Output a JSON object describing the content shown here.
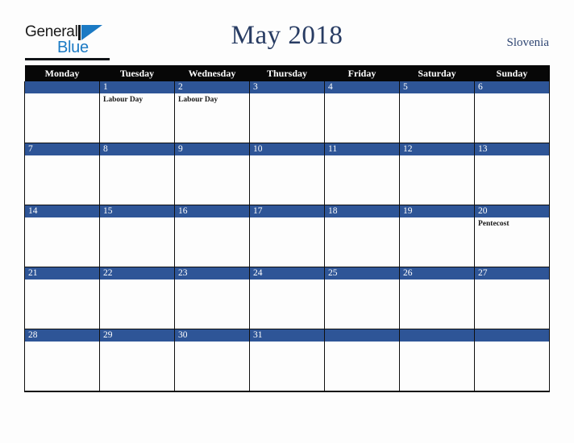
{
  "header": {
    "logo": {
      "word_top": "General",
      "word_bottom": "Blue",
      "triangle_icon": "blue-triangle-icon"
    },
    "title": "May 2018",
    "country": "Slovenia"
  },
  "calendar": {
    "weekday_headers": [
      "Monday",
      "Tuesday",
      "Wednesday",
      "Thursday",
      "Friday",
      "Saturday",
      "Sunday"
    ],
    "weeks": [
      [
        {
          "day": "",
          "events": []
        },
        {
          "day": "1",
          "events": [
            "Labour Day"
          ]
        },
        {
          "day": "2",
          "events": [
            "Labour Day"
          ]
        },
        {
          "day": "3",
          "events": []
        },
        {
          "day": "4",
          "events": []
        },
        {
          "day": "5",
          "events": []
        },
        {
          "day": "6",
          "events": []
        }
      ],
      [
        {
          "day": "7",
          "events": []
        },
        {
          "day": "8",
          "events": []
        },
        {
          "day": "9",
          "events": []
        },
        {
          "day": "10",
          "events": []
        },
        {
          "day": "11",
          "events": []
        },
        {
          "day": "12",
          "events": []
        },
        {
          "day": "13",
          "events": []
        }
      ],
      [
        {
          "day": "14",
          "events": []
        },
        {
          "day": "15",
          "events": []
        },
        {
          "day": "16",
          "events": []
        },
        {
          "day": "17",
          "events": []
        },
        {
          "day": "18",
          "events": []
        },
        {
          "day": "19",
          "events": []
        },
        {
          "day": "20",
          "events": [
            "Pentecost"
          ]
        }
      ],
      [
        {
          "day": "21",
          "events": []
        },
        {
          "day": "22",
          "events": []
        },
        {
          "day": "23",
          "events": []
        },
        {
          "day": "24",
          "events": []
        },
        {
          "day": "25",
          "events": []
        },
        {
          "day": "26",
          "events": []
        },
        {
          "day": "27",
          "events": []
        }
      ],
      [
        {
          "day": "28",
          "events": []
        },
        {
          "day": "29",
          "events": []
        },
        {
          "day": "30",
          "events": []
        },
        {
          "day": "31",
          "events": []
        },
        {
          "day": "",
          "events": []
        },
        {
          "day": "",
          "events": []
        },
        {
          "day": "",
          "events": []
        }
      ]
    ]
  },
  "colors": {
    "day_bar": "#2e5597",
    "header_row": "#070707",
    "title_text": "#283c63",
    "logo_blue": "#1b7ac4",
    "page_background": "#fdfdfd"
  }
}
